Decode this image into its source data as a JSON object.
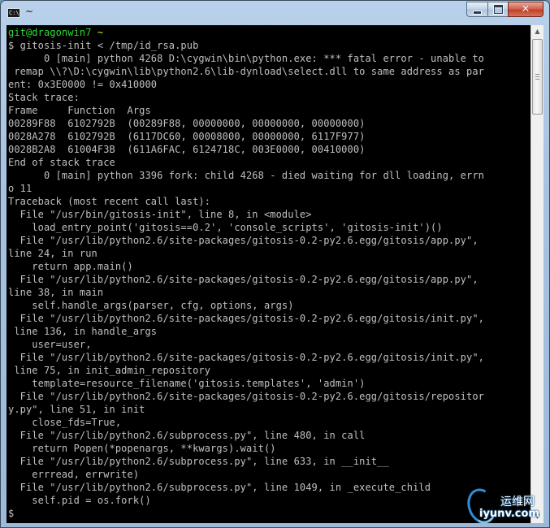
{
  "window": {
    "icon_label": "C:\\",
    "title": "~"
  },
  "controls": {
    "minimize": "minimize",
    "maximize": "maximize",
    "close": "close"
  },
  "colors": {
    "prompt_user": "#2fd92f",
    "prompt_path": "#e6e62e",
    "text": "#c0c0c0",
    "background": "#000000"
  },
  "console": {
    "lines": [
      {
        "text": "git@dragonwin7 ~",
        "style": "prompt"
      },
      {
        "text": "$ gitosis-init < /tmp/id_rsa.pub",
        "style": "normal"
      },
      {
        "text": "      0 [main] python 4268 D:\\cygwin\\bin\\python.exe: *** fatal error - unable to",
        "style": "normal"
      },
      {
        "text": " remap \\\\?\\D:\\cygwin\\lib\\python2.6\\lib-dynload\\select.dll to same address as par",
        "style": "normal"
      },
      {
        "text": "ent: 0x3E0000 != 0x410000",
        "style": "normal"
      },
      {
        "text": "Stack trace:",
        "style": "normal"
      },
      {
        "text": "Frame     Function  Args",
        "style": "normal"
      },
      {
        "text": "00289F88  6102792B  (00289F88, 00000000, 00000000, 00000000)",
        "style": "normal"
      },
      {
        "text": "0028A278  6102792B  (6117DC60, 00008000, 00000000, 6117F977)",
        "style": "normal"
      },
      {
        "text": "0028B2A8  61004F3B  (611A6FAC, 6124718C, 003E0000, 00410000)",
        "style": "normal"
      },
      {
        "text": "End of stack trace",
        "style": "normal"
      },
      {
        "text": "      0 [main] python 3396 fork: child 4268 - died waiting for dll loading, errn",
        "style": "normal"
      },
      {
        "text": "o 11",
        "style": "normal"
      },
      {
        "text": "Traceback (most recent call last):",
        "style": "normal"
      },
      {
        "text": "  File \"/usr/bin/gitosis-init\", line 8, in <module>",
        "style": "normal"
      },
      {
        "text": "    load_entry_point('gitosis==0.2', 'console_scripts', 'gitosis-init')()",
        "style": "normal"
      },
      {
        "text": "  File \"/usr/lib/python2.6/site-packages/gitosis-0.2-py2.6.egg/gitosis/app.py\",",
        "style": "normal"
      },
      {
        "text": "line 24, in run",
        "style": "normal"
      },
      {
        "text": "    return app.main()",
        "style": "normal"
      },
      {
        "text": "  File \"/usr/lib/python2.6/site-packages/gitosis-0.2-py2.6.egg/gitosis/app.py\",",
        "style": "normal"
      },
      {
        "text": "line 38, in main",
        "style": "normal"
      },
      {
        "text": "    self.handle_args(parser, cfg, options, args)",
        "style": "normal"
      },
      {
        "text": "  File \"/usr/lib/python2.6/site-packages/gitosis-0.2-py2.6.egg/gitosis/init.py\",",
        "style": "normal"
      },
      {
        "text": " line 136, in handle_args",
        "style": "normal"
      },
      {
        "text": "    user=user,",
        "style": "normal"
      },
      {
        "text": "  File \"/usr/lib/python2.6/site-packages/gitosis-0.2-py2.6.egg/gitosis/init.py\",",
        "style": "normal"
      },
      {
        "text": " line 75, in init_admin_repository",
        "style": "normal"
      },
      {
        "text": "    template=resource_filename('gitosis.templates', 'admin')",
        "style": "normal"
      },
      {
        "text": "  File \"/usr/lib/python2.6/site-packages/gitosis-0.2-py2.6.egg/gitosis/repositor",
        "style": "normal"
      },
      {
        "text": "y.py\", line 51, in init",
        "style": "normal"
      },
      {
        "text": "    close_fds=True,",
        "style": "normal"
      },
      {
        "text": "  File \"/usr/lib/python2.6/subprocess.py\", line 480, in call",
        "style": "normal"
      },
      {
        "text": "    return Popen(*popenargs, **kwargs).wait()",
        "style": "normal"
      },
      {
        "text": "  File \"/usr/lib/python2.6/subprocess.py\", line 633, in __init__",
        "style": "normal"
      },
      {
        "text": "    errread, errwrite)",
        "style": "normal"
      },
      {
        "text": "  File \"/usr/lib/python2.6/subprocess.py\", line 1049, in _execute_child",
        "style": "normal"
      },
      {
        "text": "    self.pid = os.fork()",
        "style": "normal"
      },
      {
        "text": "$",
        "style": "normal"
      }
    ]
  },
  "scrollbar": {
    "up_icon": "arrow-up-icon",
    "down_icon": "arrow-down-icon"
  },
  "watermark": {
    "brand_cn": "运维网",
    "url": "iyunv.com"
  }
}
